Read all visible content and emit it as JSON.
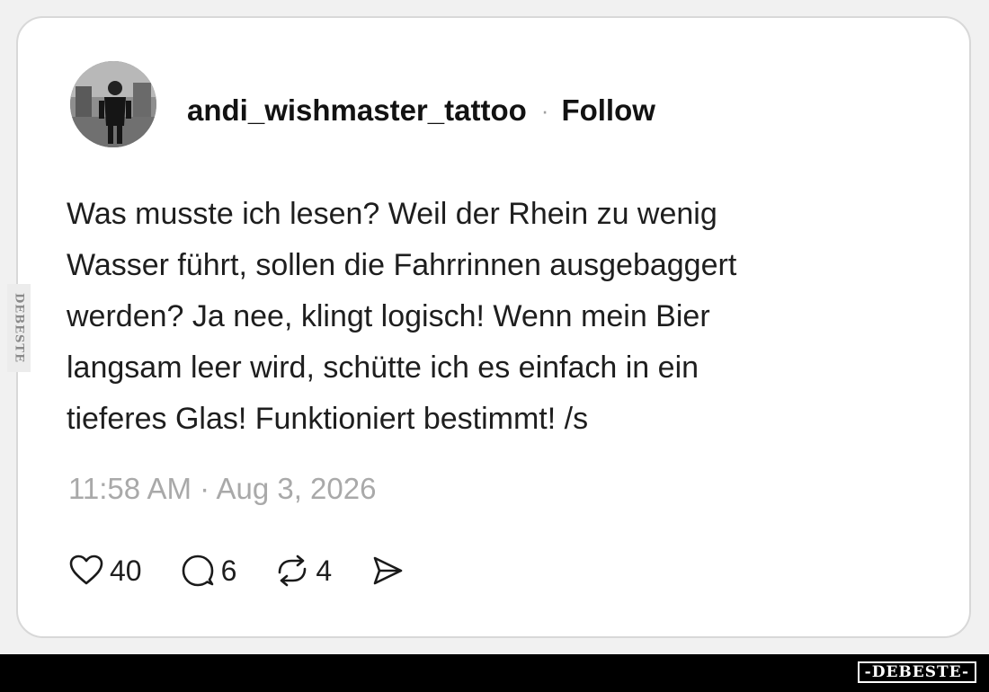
{
  "post": {
    "username": "andi_wishmaster_tattoo",
    "separator": "·",
    "follow_label": "Follow",
    "body": "Was musste ich lesen? Weil der Rhein zu wenig\nWasser führt, sollen die Fahrrinnen ausgebaggert\nwerden? Ja nee, klingt logisch! Wenn mein Bier\nlangsam leer wird, schütte ich es einfach in ein\ntieferes Glas! Funktioniert bestimmt! /s",
    "timestamp": "11:58 AM · Aug 3, 2026",
    "actions": {
      "like": {
        "icon": "heart-icon",
        "count": "40"
      },
      "reply": {
        "icon": "comment-icon",
        "count": "6"
      },
      "repost": {
        "icon": "repost-icon",
        "count": "4"
      },
      "share": {
        "icon": "share-icon"
      }
    }
  },
  "watermark": {
    "side_text": "DEBESTE",
    "footer_brand": "-DEBESTE-"
  },
  "colors": {
    "card_background": "#ffffff",
    "page_background": "#f1f1f1",
    "text": "#1e1e1e",
    "muted_text": "#a9a9a9",
    "footer_bar": "#000000"
  }
}
